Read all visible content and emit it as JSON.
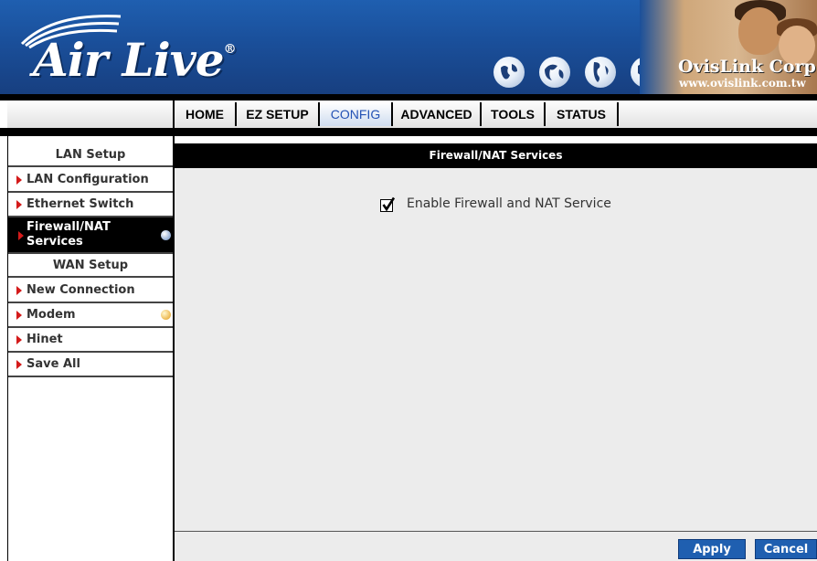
{
  "header": {
    "logo_text": "Air Live",
    "logo_mark": "®",
    "corp_name": "OvisLink Corp.",
    "corp_url": "www.ovislink.com.tw",
    "globe_icons": [
      "globe-icon",
      "globe-icon",
      "globe-icon",
      "globe-icon"
    ]
  },
  "nav": {
    "tabs": [
      {
        "label": "HOME",
        "active": false
      },
      {
        "label": "EZ SETUP",
        "active": false
      },
      {
        "label": "CONFIG",
        "active": true
      },
      {
        "label": "ADVANCED",
        "active": false
      },
      {
        "label": "TOOLS",
        "active": false
      },
      {
        "label": "STATUS",
        "active": false
      }
    ]
  },
  "sidebar": {
    "lan_header": "LAN Setup",
    "wan_header": "WAN Setup",
    "items": [
      {
        "label": "LAN Configuration"
      },
      {
        "label": "Ethernet Switch"
      },
      {
        "label": "Firewall/NAT Services",
        "line1": "Firewall/NAT",
        "line2": "Services",
        "active": true
      },
      {
        "label": "New Connection"
      },
      {
        "label": "Modem"
      },
      {
        "label": "Hinet"
      },
      {
        "label": "Save All"
      }
    ]
  },
  "main": {
    "section_title": "Firewall/NAT Services",
    "enable_checkbox": {
      "label": "Enable Firewall and NAT Service",
      "checked": true
    }
  },
  "footer": {
    "apply_label": "Apply",
    "cancel_label": "Cancel"
  },
  "colors": {
    "banner_blue": "#1a4f9a",
    "active_tab_text": "#2452b5",
    "arrow_red": "#d41a1a",
    "button_blue": "#1f5fb0"
  }
}
